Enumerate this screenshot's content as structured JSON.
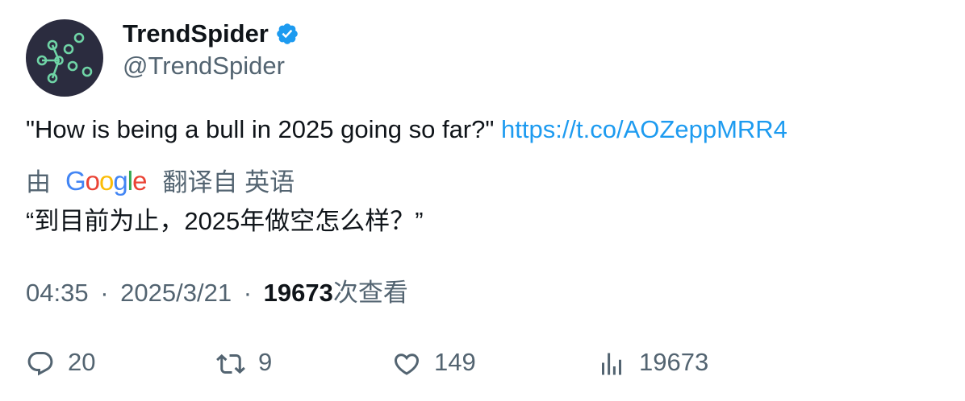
{
  "author": {
    "display_name": "TrendSpider",
    "handle": "@TrendSpider",
    "verified": true
  },
  "tweet": {
    "text": "\"How is being a bull in 2025 going so far?\"",
    "link": "https://t.co/AOZeppMRR4"
  },
  "translation": {
    "by": "由",
    "provider": "Google",
    "from_label": "翻译自 英语",
    "text": "“到目前为止，2025年做空怎么样？”"
  },
  "meta": {
    "time": "04:35",
    "date": "2025/3/21",
    "separator": "·",
    "views_count": "19673",
    "views_label": "次查看"
  },
  "actions": {
    "reply_count": "20",
    "retweet_count": "9",
    "like_count": "149",
    "views_count": "19673"
  },
  "colors": {
    "link": "#1d9bf0",
    "secondary_text": "#536471",
    "primary_text": "#0f1419",
    "avatar_bg": "#2b2c3f",
    "avatar_accent": "#6fd4a6"
  },
  "icons": {
    "avatar": "network-nodes-icon",
    "verified": "verified-badge-icon",
    "reply": "reply-icon",
    "retweet": "retweet-icon",
    "like": "heart-icon",
    "views": "bar-chart-icon"
  }
}
